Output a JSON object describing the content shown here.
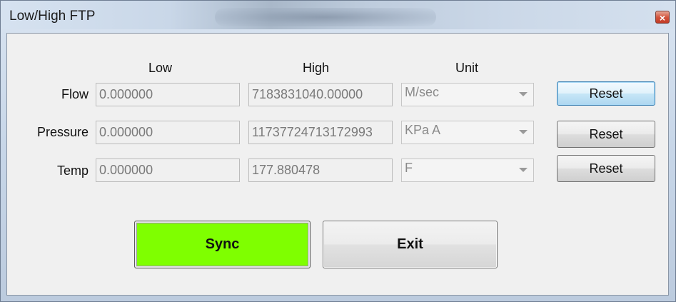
{
  "window": {
    "title": "Low/High FTP",
    "close_glyph": "×"
  },
  "columns": {
    "low": "Low",
    "high": "High",
    "unit": "Unit"
  },
  "rows": [
    {
      "label": "Flow",
      "low": "0.000000",
      "high": "7183831040.00000",
      "unit": "M/sec",
      "reset": "Reset"
    },
    {
      "label": "Pressure",
      "low": "0.000000",
      "high": "11737724713172993",
      "unit": "KPa A",
      "reset": "Reset"
    },
    {
      "label": "Temp",
      "low": "0.000000",
      "high": "177.880478",
      "unit": "F",
      "reset": "Reset"
    }
  ],
  "actions": {
    "sync": "Sync",
    "exit": "Exit"
  },
  "colors": {
    "sync_bg": "#7fff00",
    "close_btn": "#c23a24"
  }
}
